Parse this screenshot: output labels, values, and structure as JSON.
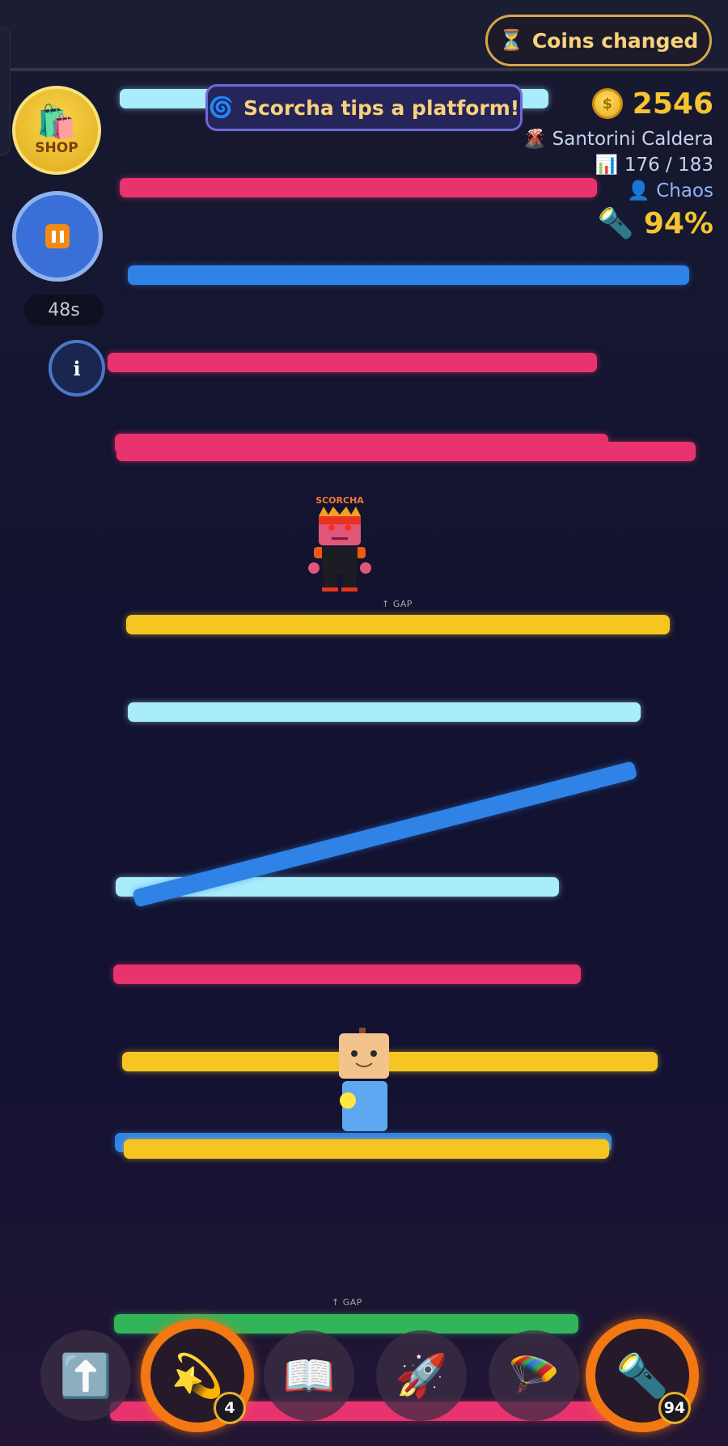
{
  "hud": {
    "coins": "2546",
    "level_name": "Santorini Caldera",
    "level_icon": "volcano-icon",
    "progress_text": "176 / 183",
    "mode": "Chaos",
    "flashlight_percent": "94%"
  },
  "notifications": {
    "coins_changed": "Coins changed",
    "event_toast": "Scorcha tips a platform!"
  },
  "sidebar": {
    "shop_label": "SHOP",
    "timer": "48s",
    "info_label": "i"
  },
  "world": {
    "enemy_name": "SCORCHA",
    "gap_label_1": "↑ GAP",
    "gap_label_2": "↑ GAP",
    "platform_colors": {
      "cyan": "#a9ecfb",
      "pink": "#e8336e",
      "blue": "#2f82e6",
      "yellow": "#f5c622",
      "green": "#31b45a"
    }
  },
  "dock": {
    "items": [
      {
        "name": "jump-boost",
        "icon": "up-arrow-icon",
        "count": ""
      },
      {
        "name": "star-dash",
        "icon": "shooting-star-icon",
        "count": "4"
      },
      {
        "name": "guide-book",
        "icon": "book-icon",
        "count": ""
      },
      {
        "name": "rocket",
        "icon": "rocket-icon",
        "count": ""
      },
      {
        "name": "parachute",
        "icon": "parachute-icon",
        "count": ""
      },
      {
        "name": "flashlight",
        "icon": "flashlight-icon",
        "count": "94"
      }
    ]
  }
}
